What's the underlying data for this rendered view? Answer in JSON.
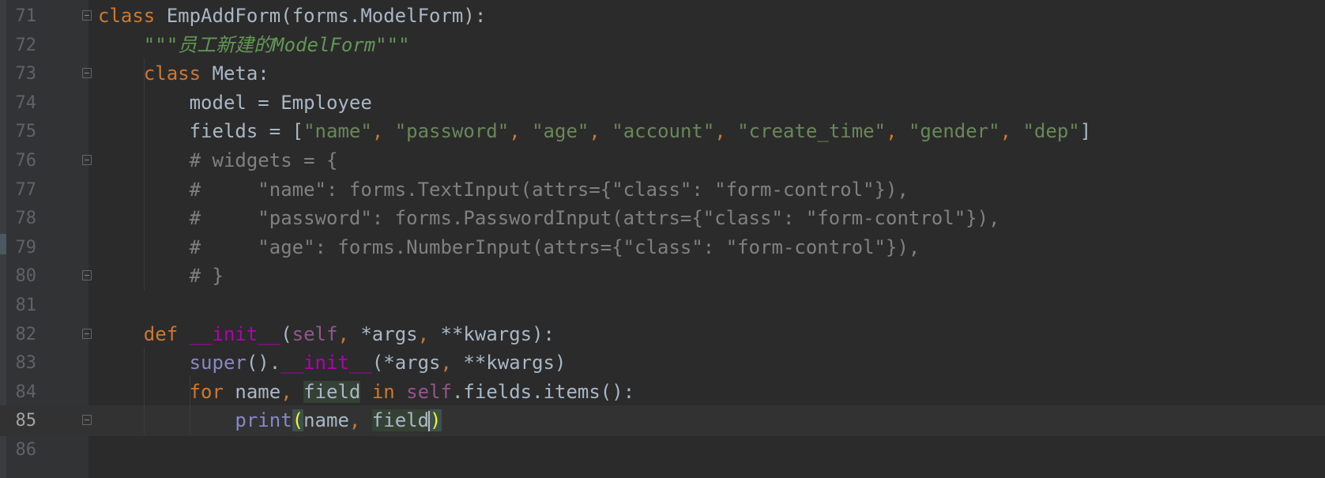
{
  "editor": {
    "lines": [
      {
        "num": "71",
        "indent": "",
        "segments": [
          [
            "class",
            "kw"
          ],
          [
            " EmpAddForm(forms.ModelForm):",
            ""
          ]
        ]
      },
      {
        "num": "72",
        "indent": "    ",
        "segments": [
          [
            "\"\"\"员工新建的ModelForm\"\"\"",
            "doc"
          ]
        ]
      },
      {
        "num": "73",
        "indent": "    ",
        "segments": [
          [
            "class",
            "kw"
          ],
          [
            " Meta:",
            ""
          ]
        ]
      },
      {
        "num": "74",
        "indent": "        ",
        "segments": [
          [
            "model = Employee",
            ""
          ]
        ]
      },
      {
        "num": "75",
        "indent": "        ",
        "segments": [
          [
            "fields = [",
            ""
          ],
          [
            "\"name\"",
            "str"
          ],
          [
            ", ",
            "kw"
          ],
          [
            "\"password\"",
            "str"
          ],
          [
            ", ",
            "kw"
          ],
          [
            "\"age\"",
            "str"
          ],
          [
            ", ",
            "kw"
          ],
          [
            "\"account\"",
            "str"
          ],
          [
            ", ",
            "kw"
          ],
          [
            "\"create_time\"",
            "str"
          ],
          [
            ", ",
            "kw"
          ],
          [
            "\"gender\"",
            "str"
          ],
          [
            ", ",
            "kw"
          ],
          [
            "\"dep\"",
            "str"
          ],
          [
            "]",
            ""
          ]
        ]
      },
      {
        "num": "76",
        "indent": "        ",
        "segments": [
          [
            "# widgets = {",
            "cm"
          ]
        ]
      },
      {
        "num": "77",
        "indent": "        ",
        "segments": [
          [
            "#     \"name\": forms.TextInput(attrs={\"class\": \"form-control\"}),",
            "cm"
          ]
        ]
      },
      {
        "num": "78",
        "indent": "        ",
        "segments": [
          [
            "#     \"password\": forms.PasswordInput(attrs={\"class\": \"form-control\"}),",
            "cm"
          ]
        ]
      },
      {
        "num": "79",
        "indent": "        ",
        "segments": [
          [
            "#     \"age\": forms.NumberInput(attrs={\"class\": \"form-control\"}),",
            "cm"
          ]
        ]
      },
      {
        "num": "80",
        "indent": "        ",
        "segments": [
          [
            "# }",
            "cm"
          ]
        ]
      },
      {
        "num": "81",
        "indent": "",
        "segments": []
      },
      {
        "num": "82",
        "indent": "    ",
        "segments": [
          [
            "def",
            "kw"
          ],
          [
            " ",
            ""
          ],
          [
            "__init__",
            "dunder"
          ],
          [
            "(",
            ""
          ],
          [
            "self",
            "selfkw"
          ],
          [
            ", ",
            "kw"
          ],
          [
            "*args",
            ""
          ],
          [
            ", ",
            "kw"
          ],
          [
            "**kwargs):",
            ""
          ]
        ]
      },
      {
        "num": "83",
        "indent": "        ",
        "segments": [
          [
            "super",
            "bi"
          ],
          [
            "().",
            ""
          ],
          [
            "__init__",
            "dunder"
          ],
          [
            "(*args",
            ""
          ],
          [
            ", ",
            "kw"
          ],
          [
            "**kwargs)",
            ""
          ]
        ]
      },
      {
        "num": "84",
        "indent": "        ",
        "segments": [
          [
            "for",
            "kw"
          ],
          [
            " name",
            ""
          ],
          [
            ", ",
            "kw"
          ],
          [
            "field",
            "hlword"
          ],
          [
            " ",
            ""
          ],
          [
            "in",
            "kw"
          ],
          [
            " ",
            ""
          ],
          [
            "self",
            "selfkw"
          ],
          [
            ".fields.items():",
            ""
          ]
        ]
      },
      {
        "num": "85",
        "indent": "            ",
        "segments": [
          [
            "print",
            "bi"
          ],
          [
            "(",
            "brace"
          ],
          [
            "name",
            ""
          ],
          [
            ", ",
            "kw"
          ],
          [
            "field",
            "hlword"
          ],
          [
            "CARET",
            ""
          ],
          [
            ")",
            "brace"
          ]
        ]
      },
      {
        "num": "86",
        "indent": "",
        "segments": []
      }
    ]
  }
}
